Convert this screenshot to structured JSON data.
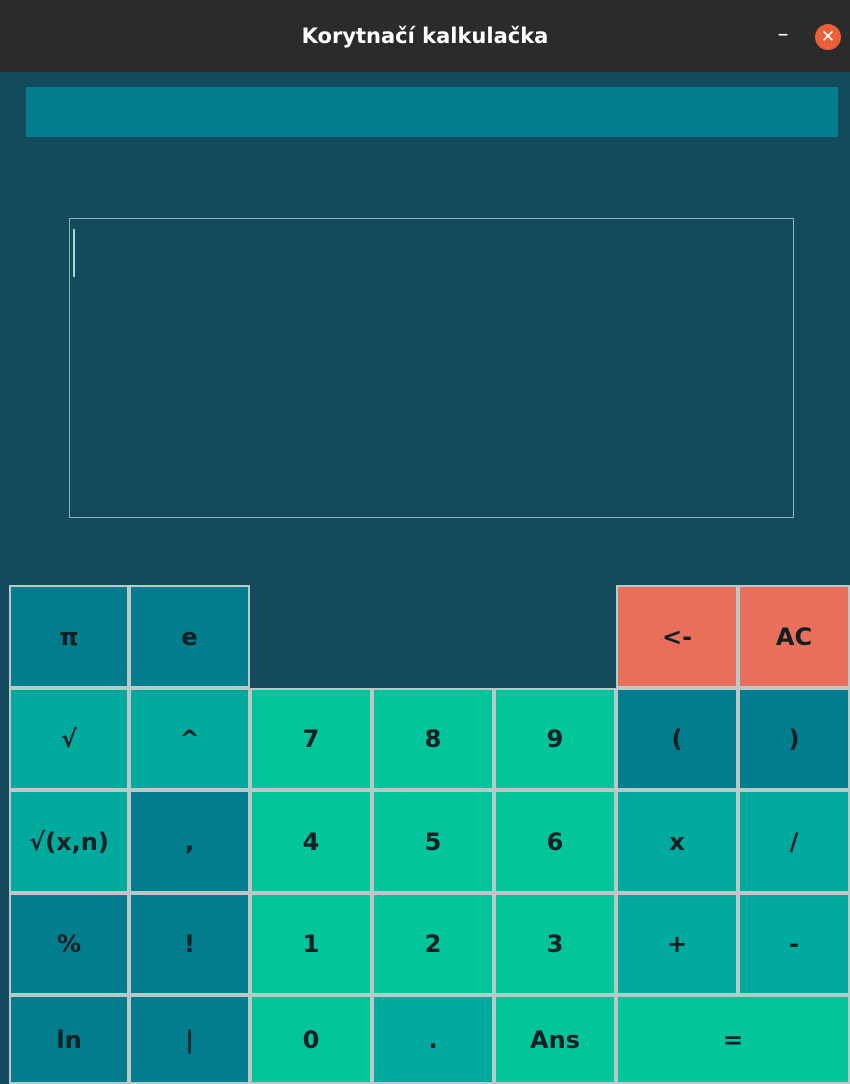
{
  "window": {
    "title": "Korytnačí kalkulačka",
    "minimize_symbol": "–",
    "close_symbol": "✕"
  },
  "display": {
    "value": ""
  },
  "buttons": {
    "pi": "π",
    "e": "e",
    "backspace": "<-",
    "all_clear": "AC",
    "sqrt": "√",
    "power": "^",
    "seven": "7",
    "eight": "8",
    "nine": "9",
    "left_paren": "(",
    "right_paren": ")",
    "nth_root": "√(x,n)",
    "comma": ",",
    "four": "4",
    "five": "5",
    "six": "6",
    "multiply": "x",
    "divide": "/",
    "percent": "%",
    "factorial": "!",
    "one": "1",
    "two": "2",
    "three": "3",
    "plus": "+",
    "minus": "-",
    "ln": "ln",
    "abs": "|",
    "zero": "0",
    "decimal": ".",
    "ans": "Ans",
    "equals": "="
  },
  "colors": {
    "background": "#134b5c",
    "titlebar": "#2b2b2b",
    "dark_teal": "#017d8d",
    "mid_teal": "#00aa9c",
    "light_green": "#02c59b",
    "coral": "#e8705a",
    "close_button": "#e9603a"
  }
}
